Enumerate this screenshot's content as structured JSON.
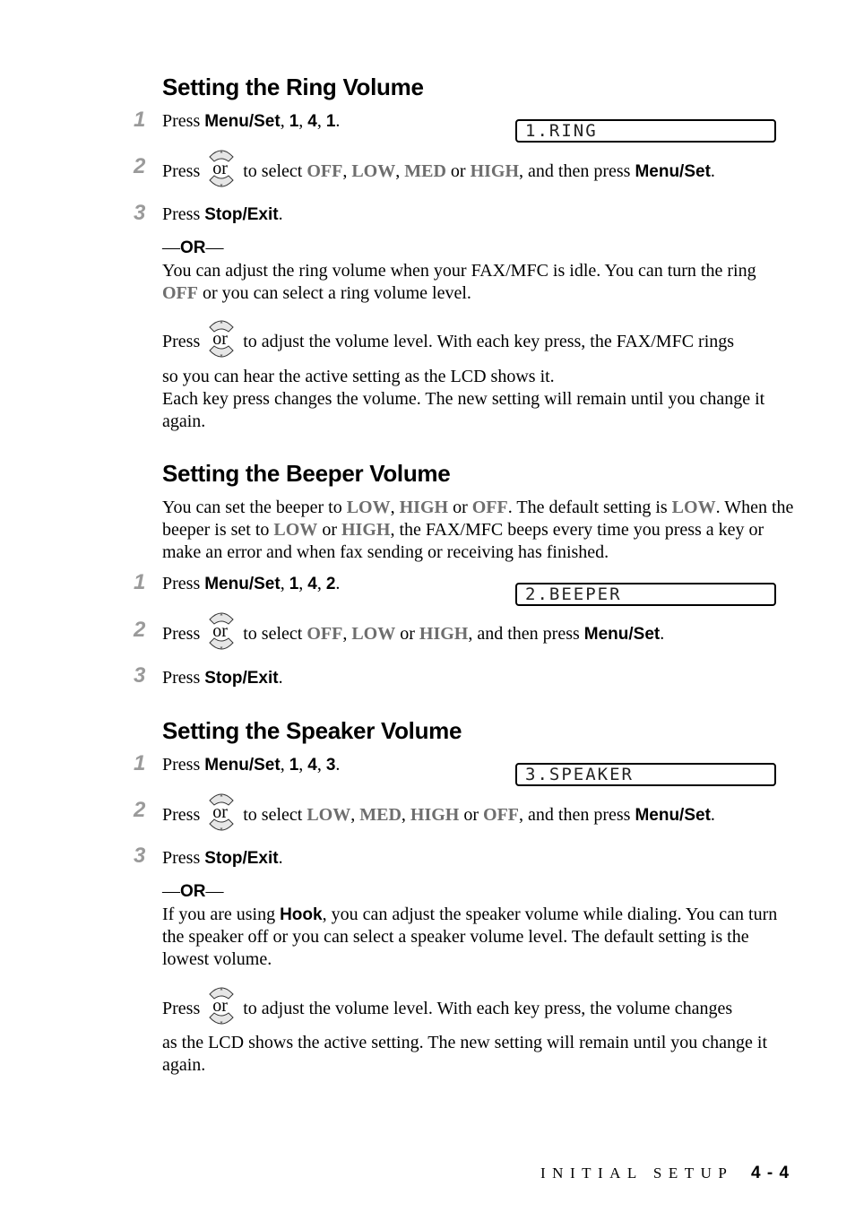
{
  "sections": {
    "ring": {
      "title": "Setting the Ring Volume",
      "lcd": "1.RING",
      "step1": {
        "number": "1",
        "prefix": "Press ",
        "key": "Menu/Set",
        "sep1": ", ",
        "d1": "1",
        "sep2": ", ",
        "d2": "4",
        "sep3": ", ",
        "d3": "1",
        "end": "."
      },
      "step2": {
        "number": "2",
        "prefix": "Press",
        "keys_label": "or",
        "mid": "to select ",
        "opt1": "OFF",
        "c1": ", ",
        "opt2": "LOW",
        "c2": ", ",
        "opt3": "MED",
        "c3": " or ",
        "opt4": "HIGH",
        "tail": ", and then press ",
        "key": "Menu/Set",
        "end": "."
      },
      "step3": {
        "number": "3",
        "prefix": "Press ",
        "key": "Stop/Exit",
        "end": "."
      },
      "or_label": "OR",
      "alt_para1_a": "You can adjust the ring volume when your FAX/MFC is idle. You can turn the ring ",
      "alt_para1_off": "OFF",
      "alt_para1_b": " or you can select a ring volume level.",
      "alt_press": "Press",
      "alt_keys_label": "or",
      "alt_press_tail": "to adjust the volume level. With each key press, the FAX/MFC rings",
      "alt_para2": "so you can hear the active setting as the LCD shows it.",
      "alt_para3": "Each key press changes the volume. The new setting will remain until you change it again."
    },
    "beeper": {
      "title": "Setting the Beeper Volume",
      "intro_a": "You can set the beeper to ",
      "intro_low": "LOW",
      "intro_c1": ", ",
      "intro_high": "HIGH",
      "intro_or": " or ",
      "intro_off": "OFF",
      "intro_b": ". The default setting is ",
      "intro_low2": "LOW",
      "intro_c": ". When the beeper is set to ",
      "intro_low3": "LOW",
      "intro_or2": " or ",
      "intro_high2": "HIGH",
      "intro_d": ", the FAX/MFC beeps every time you press a key or make an error and when fax sending or receiving has finished.",
      "lcd": "2.BEEPER",
      "step1": {
        "number": "1",
        "prefix": "Press ",
        "key": "Menu/Set",
        "sep1": ", ",
        "d1": "1",
        "sep2": ", ",
        "d2": "4",
        "sep3": ", ",
        "d3": "2",
        "end": "."
      },
      "step2": {
        "number": "2",
        "prefix": "Press",
        "keys_label": "or",
        "mid": "to select ",
        "opt1": "OFF",
        "c1": ", ",
        "opt2": "LOW",
        "c2": " or ",
        "opt3": "HIGH",
        "tail": ", and then press ",
        "key": "Menu/Set",
        "end": "."
      },
      "step3": {
        "number": "3",
        "prefix": "Press ",
        "key": "Stop/Exit",
        "end": "."
      }
    },
    "speaker": {
      "title": "Setting the Speaker Volume",
      "lcd": "3.SPEAKER",
      "step1": {
        "number": "1",
        "prefix": "Press ",
        "key": "Menu/Set",
        "sep1": ", ",
        "d1": "1",
        "sep2": ", ",
        "d2": "4",
        "sep3": ", ",
        "d3": "3",
        "end": "."
      },
      "step2": {
        "number": "2",
        "prefix": "Press",
        "keys_label": "or",
        "mid": "to select ",
        "opt1": "LOW",
        "c1": ", ",
        "opt2": "MED",
        "c2": ", ",
        "opt3": "HIGH",
        "c3": " or ",
        "opt4": "OFF",
        "tail": ", and then press ",
        "key": "Menu/Set",
        "end": "."
      },
      "step3": {
        "number": "3",
        "prefix": "Press ",
        "key": "Stop/Exit",
        "end": "."
      },
      "or_label": "OR",
      "alt_para1_a": "If you are using ",
      "alt_para1_key": "Hook",
      "alt_para1_b": ", you can adjust the speaker volume while dialing. You can turn the speaker off or you can select a speaker volume level. The default setting is the lowest volume.",
      "alt_press": "Press",
      "alt_keys_label": "or",
      "alt_press_tail": "to adjust the volume level. With each key press, the volume changes",
      "alt_para2": "as the LCD shows the active setting. The new setting will remain until you change it again."
    }
  },
  "footer": {
    "section": "INITIAL SETUP",
    "page": "4 - 4"
  },
  "colors": {
    "highlight_gray": "#6e6e6e",
    "step_number_gray": "#9a9a9a"
  }
}
